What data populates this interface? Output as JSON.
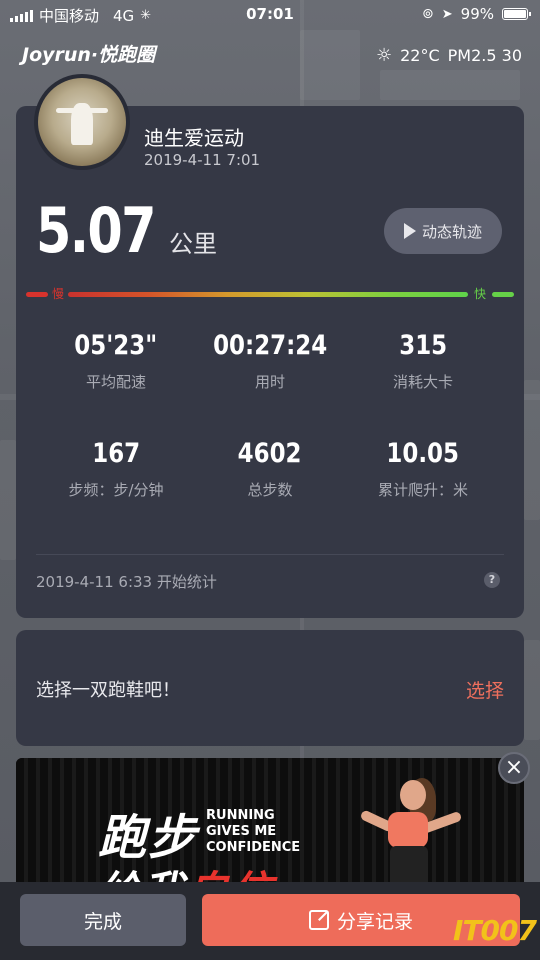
{
  "status_bar": {
    "carrier": "中国移动",
    "network": "4G",
    "time": "07:01",
    "battery": "99%",
    "battery_level": 0.99
  },
  "header": {
    "logo": "Joyrun·悦跑圈",
    "temperature": "22°C",
    "air_quality": "PM2.5 30"
  },
  "run": {
    "user_name": "迪生爱运动",
    "date": "2019-4-11 7:01",
    "distance": "5.07",
    "distance_unit": "公里",
    "track_button": "动态轨迹",
    "pace_slow": "慢",
    "pace_fast": "快",
    "stats": [
      {
        "value": "05'23\"",
        "label": "平均配速"
      },
      {
        "value": "00:27:24",
        "label": "用时"
      },
      {
        "value": "315",
        "label": "消耗大卡"
      },
      {
        "value": "167",
        "label": "步频：步/分钟"
      },
      {
        "value": "4602",
        "label": "总步数"
      },
      {
        "value": "10.05",
        "label": "累计爬升：米"
      }
    ],
    "start_text": "2019-4-11 6:33 开始统计",
    "help": "?"
  },
  "shoe": {
    "prompt": "选择一双跑鞋吧！",
    "select": "选择"
  },
  "ad": {
    "headline_1": "跑步",
    "headline_2a": "给我",
    "headline_2b": "自信",
    "slogan_1": "RUNNING",
    "slogan_2": "GIVES ME",
    "slogan_3": "CONFIDENCE",
    "close": "×"
  },
  "bottom": {
    "done": "完成",
    "share": "分享记录"
  },
  "watermark": "IT007",
  "colors": {
    "card_bg": "#353845",
    "accent": "#ee6c5a",
    "slow": "#d8332d",
    "fast": "#66d148"
  }
}
